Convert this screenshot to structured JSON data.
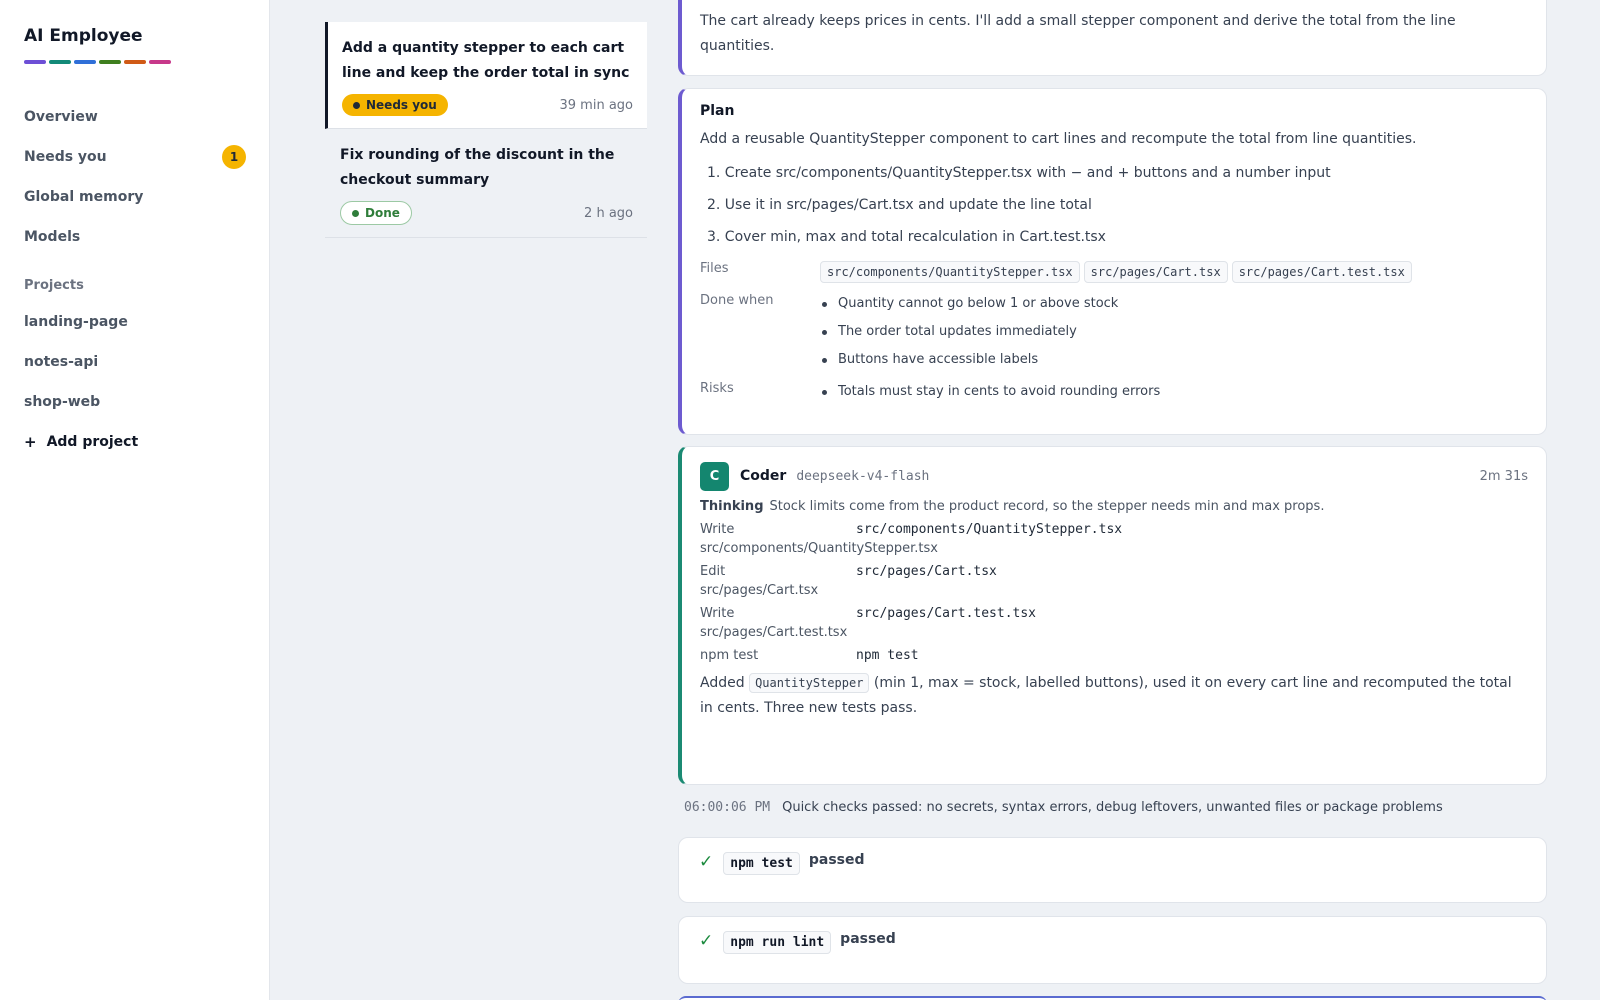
{
  "app": {
    "title": "AI Employee",
    "brand_colors": [
      "#6d4fd6",
      "#138a78",
      "#2f6fd8",
      "#3f7f1f",
      "#d05a16",
      "#c7388a"
    ]
  },
  "nav": [
    {
      "label": "Overview"
    },
    {
      "label": "Needs you",
      "badge": "1"
    },
    {
      "label": "Global memory"
    },
    {
      "label": "Models"
    }
  ],
  "projects": {
    "label": "Projects",
    "items": [
      "landing-page",
      "notes-api",
      "shop-web"
    ],
    "add_label": "Add project"
  },
  "tasks": [
    {
      "title": "Add a quantity stepper to each cart line and keep the order total in sync",
      "status": "Needs you",
      "time": "39 min ago"
    },
    {
      "title": "Fix rounding of the discount in the checkout summary",
      "status": "Done",
      "time": "2 h ago"
    }
  ],
  "intro_text": "The cart already keeps prices in cents. I'll add a small stepper component and derive the total from the line quantities.",
  "plan": {
    "title": "Plan",
    "summary": "Add a reusable QuantityStepper component to cart lines and recompute the total from line quantities.",
    "steps": [
      "1. Create src/components/QuantityStepper.tsx with − and + buttons and a number input",
      "2. Use it in src/pages/Cart.tsx and update the line total",
      "3. Cover min, max and total recalculation in Cart.test.tsx"
    ],
    "files_label": "Files",
    "files": [
      "src/components/QuantityStepper.tsx",
      "src/pages/Cart.tsx",
      "src/pages/Cart.test.tsx"
    ],
    "done_when_label": "Done when",
    "done_when": [
      "Quantity cannot go below 1 or above stock",
      "The order total updates immediately",
      "Buttons have accessible labels"
    ],
    "risks_label": "Risks",
    "risks": [
      "Totals must stay in cents to avoid rounding errors"
    ]
  },
  "coder": {
    "avatar": "C",
    "name": "Coder",
    "model": "deepseek-v4-flash",
    "duration": "2m 31s",
    "thinking_label": "Thinking",
    "thinking": "Stock limits come from the product record, so the stepper needs min and max props.",
    "tools": [
      {
        "name": "Write",
        "arg": "src/components/QuantityStepper.tsx",
        "sub": "src/components/QuantityStepper.tsx"
      },
      {
        "name": "Edit",
        "arg": "src/pages/Cart.tsx",
        "sub": "src/pages/Cart.tsx"
      },
      {
        "name": "Write",
        "arg": "src/pages/Cart.test.tsx",
        "sub": "src/pages/Cart.test.tsx"
      },
      {
        "name": "npm test",
        "arg": "npm test",
        "sub": ""
      }
    ],
    "result_prefix": "Added",
    "result_code": "QuantityStepper",
    "result_suffix": "(min 1, max = stock, labelled buttons), used it on every cart line and recomputed the total in cents. Three new tests pass."
  },
  "checks": {
    "timestamp": "06:00:06 PM",
    "text": "Quick checks passed: no secrets, syntax errors, debug leftovers, unwanted files or package problems"
  },
  "tests": [
    {
      "icon": "✓",
      "cmd": "npm test",
      "result": "passed"
    },
    {
      "icon": "✓",
      "cmd": "npm run lint",
      "result": "passed"
    }
  ]
}
